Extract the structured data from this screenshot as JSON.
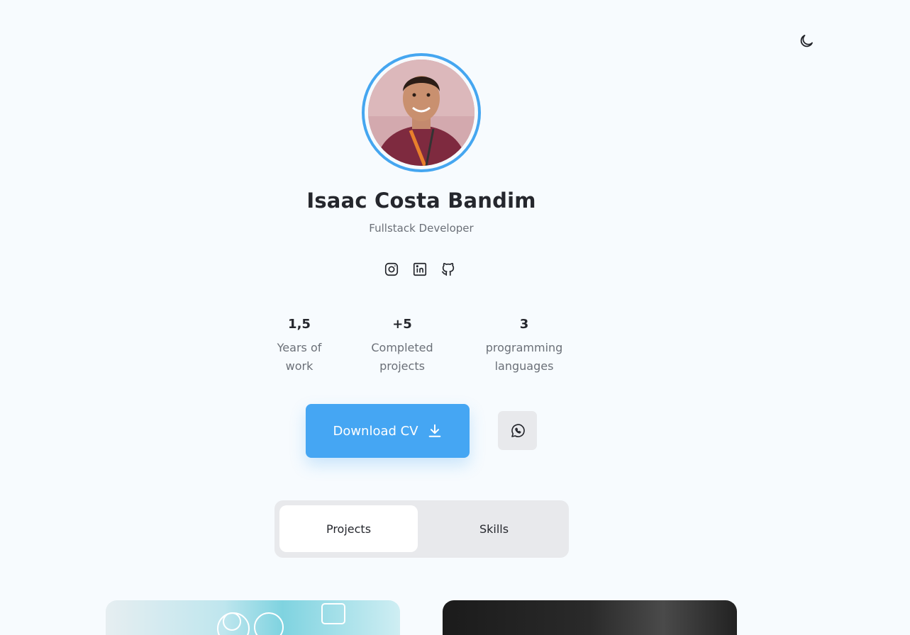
{
  "profile": {
    "name": "Isaac Costa Bandim",
    "role": "Fullstack Developer"
  },
  "socials": [
    {
      "icon": "instagram-icon"
    },
    {
      "icon": "linkedin-icon"
    },
    {
      "icon": "github-icon"
    }
  ],
  "stats": [
    {
      "value": "1,5",
      "label_line1": "Years of",
      "label_line2": "work"
    },
    {
      "value": "+5",
      "label_line1": "Completed",
      "label_line2": "projects"
    },
    {
      "value": "3",
      "label_line1": "programming",
      "label_line2": "languages"
    }
  ],
  "actions": {
    "download_cv_label": "Download CV",
    "download_icon": "download-icon",
    "whatsapp_icon": "whatsapp-icon"
  },
  "tabs": [
    {
      "label": "Projects",
      "active": true
    },
    {
      "label": "Skills",
      "active": false
    }
  ],
  "theme_toggle_icon": "moon-icon",
  "colors": {
    "accent": "#45a6f3",
    "background": "#f7fbfe",
    "tab_bg": "#e8e9ec"
  }
}
